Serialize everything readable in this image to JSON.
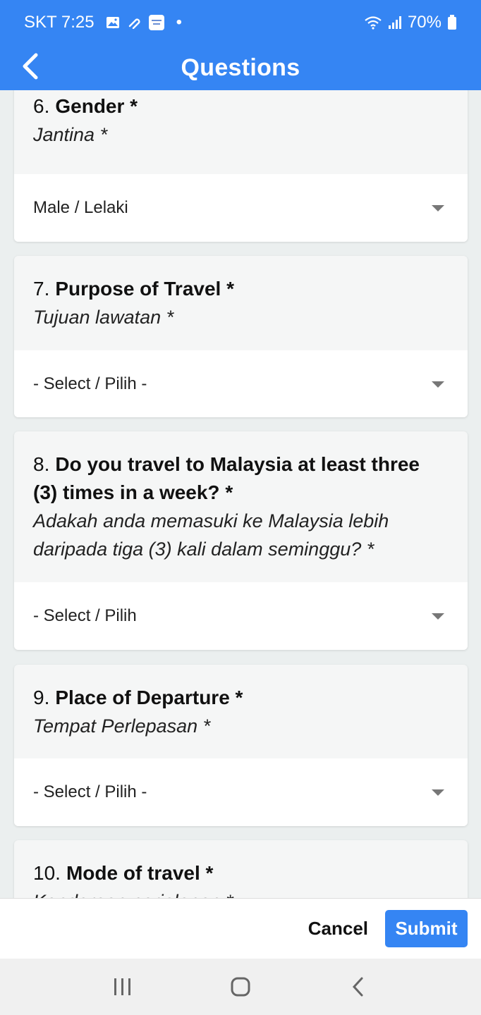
{
  "status_bar": {
    "carrier_time": "SKT 7:25",
    "dot": "•",
    "battery": "70%",
    "icons": [
      "image-icon",
      "paperclip-icon",
      "app-notification-icon",
      "wifi-icon",
      "signal-icon",
      "battery-icon"
    ]
  },
  "header": {
    "title": "Questions",
    "back_icon": "chevron-left-icon"
  },
  "questions": [
    {
      "number": "6.",
      "label": "Gender *",
      "sublabel": "Jantina *",
      "value": "Male / Lelaki"
    },
    {
      "number": "7.",
      "label": "Purpose of Travel *",
      "sublabel": "Tujuan lawatan *",
      "value": "- Select / Pilih -"
    },
    {
      "number": "8.",
      "label": "Do you travel to Malaysia at least three (3) times in a week? *",
      "sublabel": "Adakah anda memasuki ke Malaysia lebih daripada tiga (3) kali dalam seminggu? *",
      "value": "- Select / Pilih"
    },
    {
      "number": "9.",
      "label": "Place of Departure *",
      "sublabel": "Tempat Perlepasan *",
      "value": "- Select / Pilih -"
    },
    {
      "number": "10.",
      "label": "Mode of travel *",
      "sublabel": "Kenderaan perjalanan *"
    }
  ],
  "actions": {
    "cancel_label": "Cancel",
    "submit_label": "Submit"
  },
  "colors": {
    "primary": "#3585f3",
    "background": "#ebefef",
    "card_header": "#f5f6f6"
  }
}
